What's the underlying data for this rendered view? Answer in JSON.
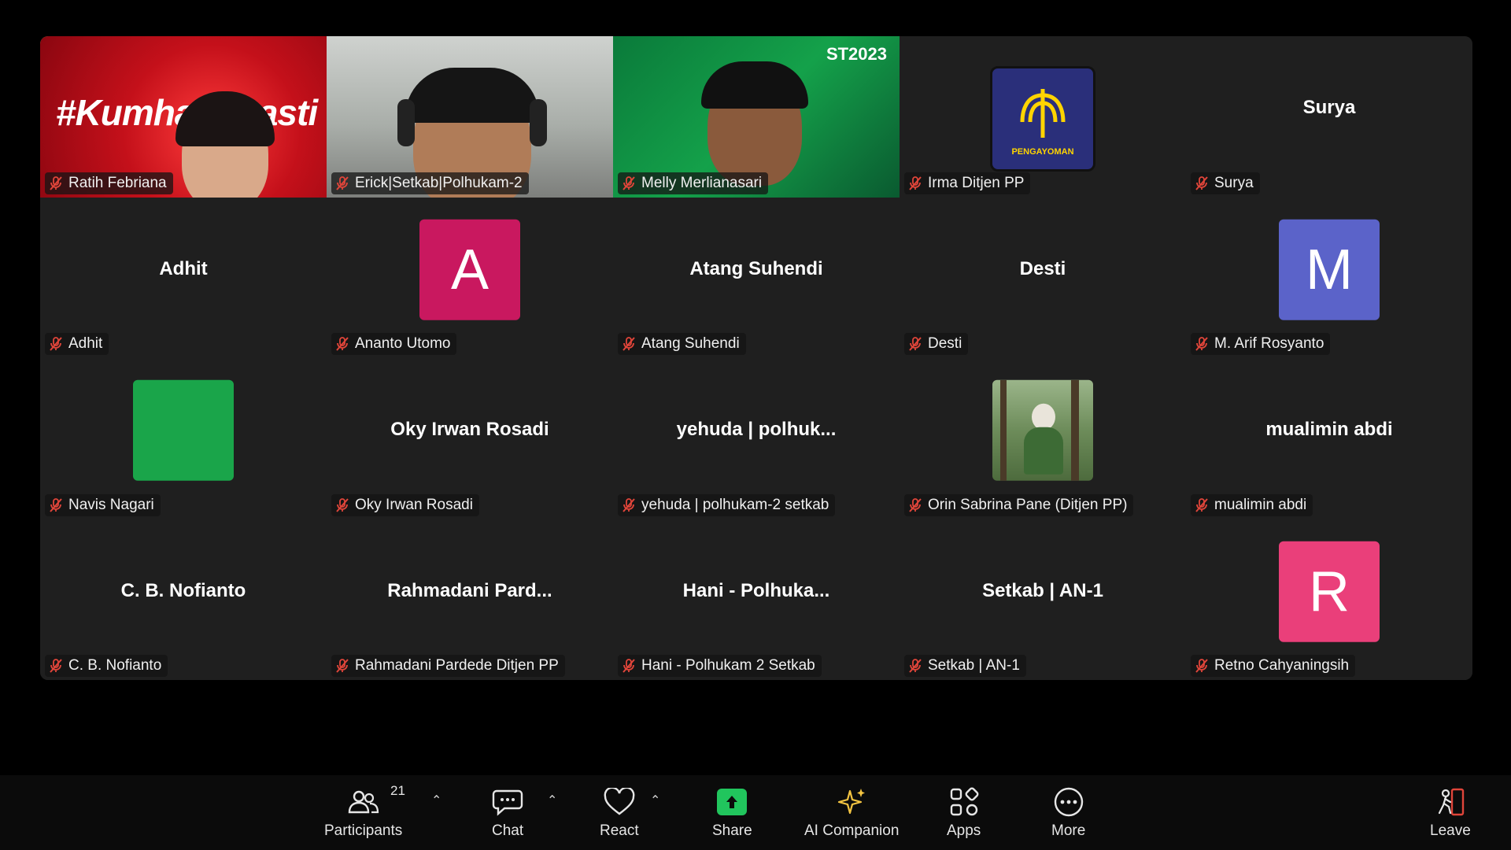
{
  "participants": [
    {
      "name": "Ratih Febriana",
      "kind": "video",
      "scene": "red",
      "active": true,
      "overlay_text": "#Kumham Pasti"
    },
    {
      "name": "Erick|Setkab|Polhukam-2",
      "kind": "video",
      "scene": "room"
    },
    {
      "name": "Melly Merlianasari",
      "kind": "video",
      "scene": "green",
      "overlay_text": "ST2023"
    },
    {
      "name": "Irma Ditjen PP",
      "kind": "logo",
      "logo_text": "PENGAYOMAN"
    },
    {
      "name": "Surya",
      "kind": "text",
      "display": "Surya"
    },
    {
      "name": "Adhit",
      "kind": "text",
      "display": "Adhit"
    },
    {
      "name": "Ananto Utomo",
      "kind": "letter",
      "letter": "A",
      "color": "#c9185f"
    },
    {
      "name": "Atang Suhendi",
      "kind": "text",
      "display": "Atang Suhendi"
    },
    {
      "name": "Desti",
      "kind": "text",
      "display": "Desti"
    },
    {
      "name": "M. Arif Rosyanto",
      "kind": "letter",
      "letter": "M",
      "color": "#5b63c9"
    },
    {
      "name": "Navis Nagari",
      "kind": "letter",
      "letter": "",
      "color": "#1aa54a"
    },
    {
      "name": "Oky Irwan Rosadi",
      "kind": "text",
      "display": "Oky Irwan Rosadi"
    },
    {
      "name": "yehuda | polhukam-2 setkab",
      "kind": "text",
      "display": "yehuda  |  polhuk..."
    },
    {
      "name": "Orin Sabrina Pane (Ditjen PP)",
      "kind": "photo"
    },
    {
      "name": "mualimin abdi",
      "kind": "text",
      "display": "mualimin abdi"
    },
    {
      "name": "C. B. Nofianto",
      "kind": "text",
      "display": "C. B. Nofianto"
    },
    {
      "name": "Rahmadani Pardede Ditjen PP",
      "kind": "text",
      "display": "Rahmadani  Pard..."
    },
    {
      "name": "Hani - Polhukam 2 Setkab",
      "kind": "text",
      "display": "Hani  -  Polhuka..."
    },
    {
      "name": "Setkab | AN-1",
      "kind": "text",
      "display": "Setkab | AN-1"
    },
    {
      "name": "Retno Cahyaningsih",
      "kind": "letter",
      "letter": "R",
      "color": "#ea3f7a"
    }
  ],
  "toolbar": {
    "participants_label": "Participants",
    "participants_count": "21",
    "chat_label": "Chat",
    "react_label": "React",
    "share_label": "Share",
    "ai_label": "AI Companion",
    "apps_label": "Apps",
    "more_label": "More",
    "leave_label": "Leave"
  },
  "colors": {
    "active_speaker": "#22c55e",
    "share": "#21c55d",
    "muted_icon": "#e0453a",
    "ai_star": "#f5c542"
  }
}
